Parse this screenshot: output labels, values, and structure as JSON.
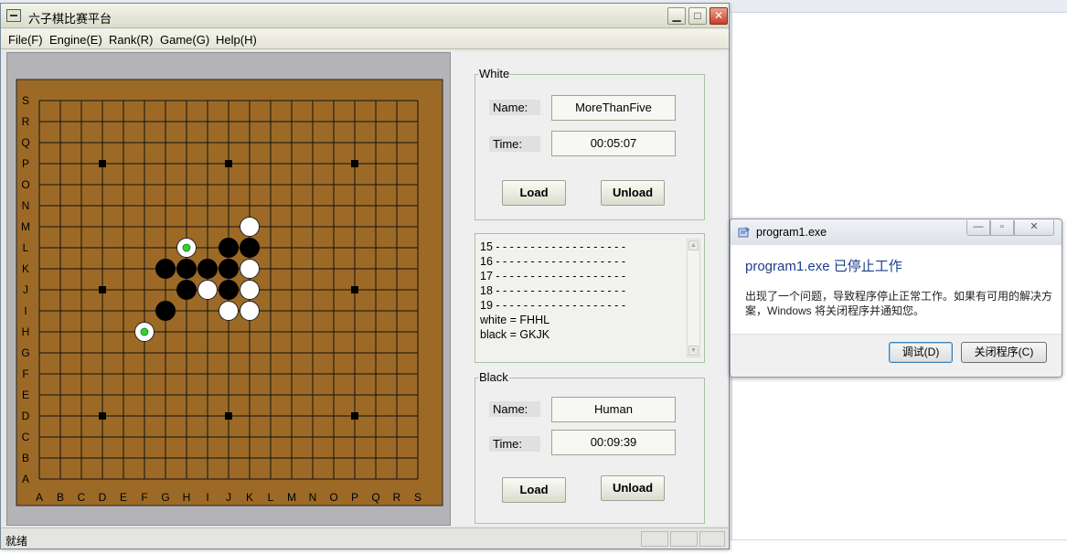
{
  "window": {
    "title": "六子棋比赛平台",
    "min_glyph": "▁",
    "max_glyph": "□",
    "close_glyph": "✕"
  },
  "menu": [
    "File(F)",
    "Engine(E)",
    "Rank(R)",
    "Game(G)",
    "Help(H)"
  ],
  "board": {
    "columns": [
      "A",
      "B",
      "C",
      "D",
      "E",
      "F",
      "G",
      "H",
      "I",
      "J",
      "K",
      "L",
      "M",
      "N",
      "O",
      "P",
      "Q",
      "R",
      "S"
    ],
    "rows": [
      "A",
      "B",
      "C",
      "D",
      "E",
      "F",
      "G",
      "H",
      "I",
      "J",
      "K",
      "L",
      "M",
      "N",
      "O",
      "P",
      "Q",
      "R",
      "S"
    ],
    "background": "#9c6a26",
    "last_move_marker": "#2fd22f",
    "star_points": [
      "D4",
      "J4",
      "P4",
      "D10",
      "P10",
      "D16",
      "J16",
      "P16"
    ],
    "black_stones": [
      "J12",
      "K12",
      "G11",
      "H11",
      "I11",
      "J11",
      "H10",
      "J10",
      "G9"
    ],
    "white_stones": [
      "K13",
      "H12",
      "K11",
      "I10",
      "K10",
      "J9",
      "K9",
      "F8"
    ],
    "last_moves": [
      "H12",
      "F8"
    ]
  },
  "white_player": {
    "legend": "White",
    "name_label": "Name:",
    "name": "MoreThanFive",
    "time_label": "Time:",
    "time": "00:05:07",
    "load": "Load",
    "unload": "Unload"
  },
  "log": {
    "lines": [
      "15 - - - - - - - - - - - - - - - - - - -",
      "16 - - - - - - - - - - - - - - - - - - -",
      "17 - - - - - - - - - - - - - - - - - - -",
      "18 - - - - - - - - - - - - - - - - - - -",
      "19 - - - - - - - - - - - - - - - - - - -",
      "white = FHHL",
      "black = GKJK"
    ]
  },
  "black_player": {
    "legend": "Black",
    "name_label": "Name:",
    "name": "Human",
    "time_label": "Time:",
    "time": "00:09:39",
    "load": "Load",
    "unload": "Unload"
  },
  "status": {
    "text": "就绪"
  },
  "dialog": {
    "title": "program1.exe",
    "heading": "program1.exe 已停止工作",
    "message": "出现了一个问题，导致程序停止正常工作。如果有可用的解决方案，Windows 将关闭程序并通知您。",
    "debug_button": "调试(D)",
    "close_program_button": "关闭程序(C)"
  }
}
